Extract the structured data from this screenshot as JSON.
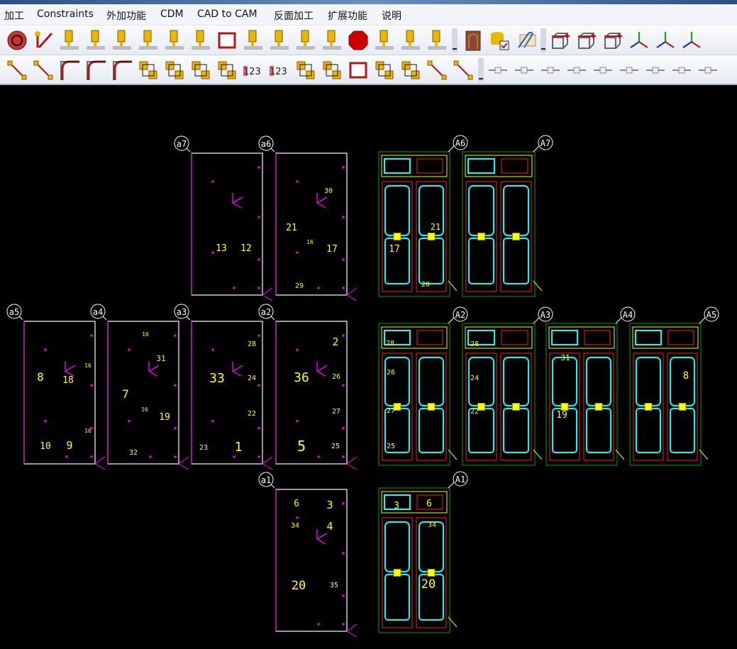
{
  "menu": [
    "加工",
    "Constraints",
    "外加功能",
    "CDM",
    "CAD to CAM",
    "反面加工",
    "扩展功能",
    "说明"
  ],
  "toolbar1": [
    "rotate-view-icon",
    "pen-draw-icon",
    "cutter-move-icon",
    "tool-path-icon",
    "surface-tool-icon",
    "pocket-tool-icon",
    "3d-path-icon",
    "drill-point-icon",
    "rectangle-icon",
    "cutter-line-icon",
    "engrave-icon",
    "tool-list-icon",
    "explode-arrows-icon",
    "stop-icon",
    "tool-cycle-icon",
    "multi-tool-icon",
    "tool-to-part-icon",
    "door-icon",
    "database-check-icon",
    "attach-mail-icon",
    "view-front-box-icon",
    "view-side-box-icon",
    "view-top-box-icon",
    "axes-iso-icon",
    "axes-front-icon",
    "axes-side-icon"
  ],
  "toolbar2": [
    "polyline-icon",
    "line-segment-icon",
    "fillet-icon",
    "chamfer-icon",
    "arc-rotate-icon",
    "diagonal-split-icon",
    "group-select-icon",
    "ungroup-icon",
    "move-to-icon",
    "number-order-icon",
    "renumber-icon",
    "stack-icon",
    "grid-array-icon",
    "frame-icon",
    "lift-up-icon",
    "slant-move-icon",
    "mirror-query-icon",
    "scale-query-icon",
    "snap-endpoint-icon",
    "snap-line-icon",
    "snap-midpoint-icon",
    "snap-center-icon",
    "snap-intersection-icon",
    "snap-tangent-icon",
    "snap-perpendicular-icon",
    "snap-parallel-icon",
    "snap-quadrant-icon"
  ],
  "colors": {
    "frame": "#ffffff",
    "label": "#ffff00",
    "marker": "#ff00ff",
    "cyan": "#00ffff",
    "red": "#ff2020",
    "green": "#00a000"
  },
  "panels": [
    {
      "id": "a7",
      "labels": [
        "13",
        "12"
      ]
    },
    {
      "id": "a6",
      "labels": [
        "30",
        "21",
        "16",
        "17",
        "29"
      ]
    },
    {
      "id": "a5",
      "labels": [
        "8",
        "18",
        "16",
        "16",
        "10",
        "9"
      ]
    },
    {
      "id": "a4",
      "labels": [
        "16",
        "31",
        "7",
        "16",
        "19",
        "32"
      ]
    },
    {
      "id": "a3",
      "labels": [
        "28",
        "33",
        "24",
        "22",
        "23",
        "1"
      ]
    },
    {
      "id": "a2",
      "labels": [
        "2",
        "36",
        "26",
        "27",
        "5",
        "25"
      ]
    },
    {
      "id": "a1",
      "labels": [
        "6",
        "3",
        "34",
        "4",
        "20",
        "35"
      ]
    },
    {
      "id": "A6",
      "labels": [
        "21",
        "17",
        "20"
      ]
    },
    {
      "id": "A7",
      "labels": []
    },
    {
      "id": "A2",
      "labels": [
        "28",
        "26",
        "27",
        "25"
      ]
    },
    {
      "id": "A3",
      "labels": [
        "28",
        "24",
        "22"
      ]
    },
    {
      "id": "A4",
      "labels": [
        "31",
        "19"
      ]
    },
    {
      "id": "A5",
      "labels": [
        "8"
      ]
    },
    {
      "id": "A1",
      "labels": [
        "3",
        "6",
        "34",
        "20"
      ]
    }
  ]
}
